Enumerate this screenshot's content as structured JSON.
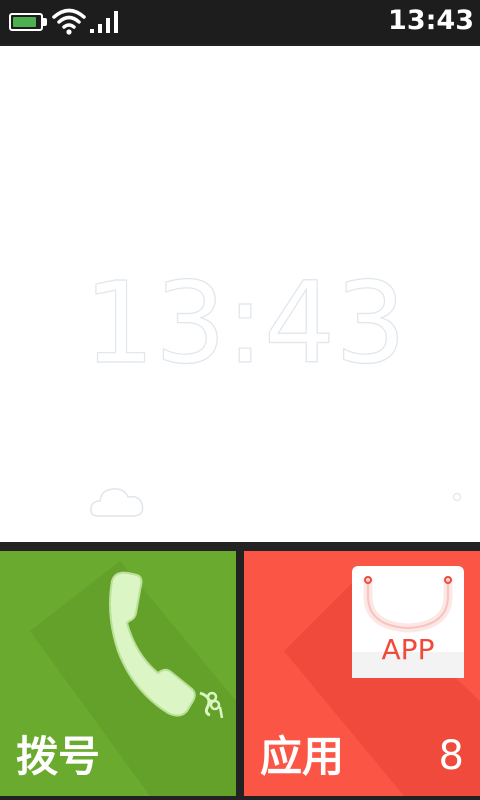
{
  "status_bar": {
    "time": "13:43",
    "battery_level": 0.9,
    "battery_color": "#4caf50",
    "wifi_icon": "wifi-icon",
    "signal_icon": "signal-icon"
  },
  "clock_widget": {
    "time": "13:43",
    "weather_icon": "cloud-icon"
  },
  "tiles": [
    {
      "label": "拨号",
      "icon": "phone-icon",
      "color": "#6aaa2e"
    },
    {
      "label": "应用",
      "icon": "app-bag-icon",
      "icon_text": "APP",
      "count": "8",
      "color": "#fb5545"
    }
  ]
}
